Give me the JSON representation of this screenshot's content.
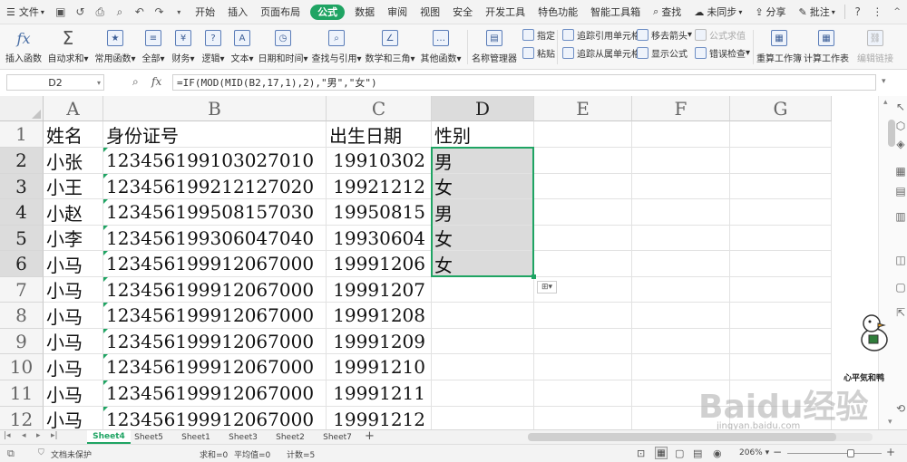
{
  "menu": {
    "file": "文件",
    "tabs": [
      "开始",
      "插入",
      "页面布局",
      "公式",
      "数据",
      "审阅",
      "视图",
      "安全",
      "开发工具",
      "特色功能",
      "智能工具箱"
    ],
    "active_tab": "公式",
    "search": "查找",
    "sync": "未同步",
    "share": "分享",
    "comment": "批注"
  },
  "ribbon": {
    "insert_function": "插入函数",
    "autosum": "自动求和",
    "common": "常用函数",
    "all": "全部",
    "finance": "财务",
    "logic": "逻辑",
    "text": "文本",
    "datetime": "日期和时间",
    "lookup": "查找与引用",
    "math": "数学和三角",
    "other": "其他函数",
    "name_manager": "名称管理器",
    "define": "指定",
    "paste": "粘贴",
    "trace_precedents": "追踪引用单元格",
    "trace_dependents": "追踪从属单元格",
    "remove_arrows": "移去箭头",
    "show_formula": "显示公式",
    "formula_eval": "公式求值",
    "error_check": "错误检查",
    "recalc_book": "重算工作簿",
    "calc_sheet": "计算工作表",
    "edit_links": "编辑链接"
  },
  "formula_bar": {
    "name_box": "D2",
    "fx": "fx",
    "formula": "=IF(MOD(MID(B2,17,1),2),\"男\",\"女\")"
  },
  "columns": [
    "A",
    "B",
    "C",
    "D",
    "E",
    "F",
    "G"
  ],
  "selected_column": "D",
  "rows": [
    {
      "n": "1",
      "a": "姓名",
      "b": "身份证号",
      "c": "出生日期",
      "d": "性别"
    },
    {
      "n": "2",
      "a": "小张",
      "b": "123456199103027010",
      "c": "19910302",
      "d": "男"
    },
    {
      "n": "3",
      "a": "小王",
      "b": "123456199212127020",
      "c": "19921212",
      "d": "女"
    },
    {
      "n": "4",
      "a": "小赵",
      "b": "123456199508157030",
      "c": "19950815",
      "d": "男"
    },
    {
      "n": "5",
      "a": "小李",
      "b": "123456199306047040",
      "c": "19930604",
      "d": "女"
    },
    {
      "n": "6",
      "a": "小马",
      "b": "123456199912067000",
      "c": "19991206",
      "d": "女"
    },
    {
      "n": "7",
      "a": "小马",
      "b": "123456199912067000",
      "c": "19991207",
      "d": ""
    },
    {
      "n": "8",
      "a": "小马",
      "b": "123456199912067000",
      "c": "19991208",
      "d": ""
    },
    {
      "n": "9",
      "a": "小马",
      "b": "123456199912067000",
      "c": "19991209",
      "d": ""
    },
    {
      "n": "10",
      "a": "小马",
      "b": "123456199912067000",
      "c": "19991210",
      "d": ""
    },
    {
      "n": "11",
      "a": "小马",
      "b": "123456199912067000",
      "c": "19991211",
      "d": ""
    },
    {
      "n": "12",
      "a": "小马",
      "b": "123456199912067000",
      "c": "19991212",
      "d": ""
    }
  ],
  "sheets": [
    "Sheet4",
    "Sheet5",
    "Sheet1",
    "Sheet3",
    "Sheet2",
    "Sheet7"
  ],
  "active_sheet": "Sheet4",
  "status": {
    "protect": "文档未保护",
    "sum": "求和=0",
    "avg": "平均值=0",
    "count": "计数=5",
    "zoom": "206%"
  },
  "watermark": {
    "brand": "Baidu经验",
    "url": "jingyan.baidu.com",
    "sticker": "心平気和鸭"
  },
  "colors": {
    "accent": "#1fa463",
    "selection_fill": "#dbdbdb"
  }
}
